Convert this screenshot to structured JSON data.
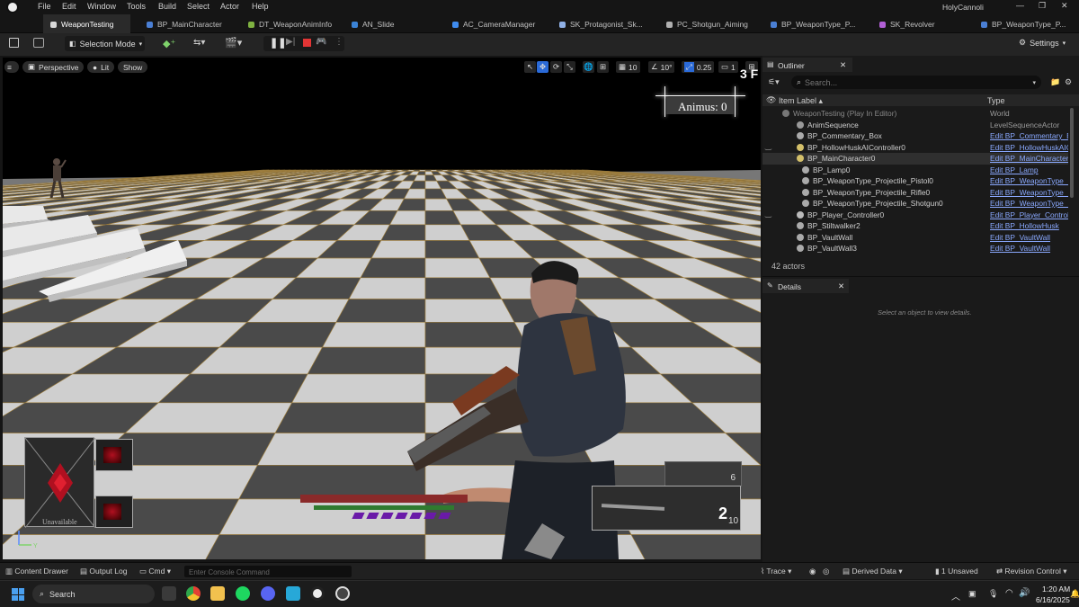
{
  "menu": [
    "File",
    "Edit",
    "Window",
    "Tools",
    "Build",
    "Select",
    "Actor",
    "Help"
  ],
  "project_name": "HolyCannoli",
  "tabs": [
    {
      "label": "WeaponTesting",
      "color": "#d8d8d8",
      "active": true
    },
    {
      "label": "BP_MainCharacter",
      "color": "#4a7fd4"
    },
    {
      "label": "DT_WeaponAnimInfo",
      "color": "#7fb241"
    },
    {
      "label": "AN_Slide",
      "color": "#3b83d6"
    },
    {
      "label": "AC_CameraManager",
      "color": "#3f8cf0"
    },
    {
      "label": "SK_Protagonist_Sk...",
      "color": "#8fb0e6"
    },
    {
      "label": "PC_Shotgun_Aiming",
      "color": "#b0b0b0"
    },
    {
      "label": "BP_WeaponType_P...",
      "color": "#4a7fd4"
    },
    {
      "label": "SK_Revolver",
      "color": "#b15fd6"
    },
    {
      "label": "BP_WeaponType_P...",
      "color": "#4a7fd4"
    }
  ],
  "toolbar": {
    "selection_mode": "Selection Mode",
    "settings": "Settings"
  },
  "viewport": {
    "perspective": "Perspective",
    "lit": "Lit",
    "show": "Show",
    "grid_snap": "10",
    "rotation_snap": "10°",
    "scale_snap": "0.25",
    "camera_speed": "1",
    "fps_fragment": "3 F",
    "animus": "Animus: 0",
    "ammo": "2",
    "ammo_reserve": "10",
    "ammo_small": "6",
    "unavailable": "Unavailable",
    "ammo_pips": 7
  },
  "outliner": {
    "title": "Outliner",
    "search_placeholder": "Search...",
    "col_label": "Item Label ▴",
    "col_type": "Type",
    "count": "42 actors",
    "rows": [
      {
        "label": "WeaponTesting (Play In Editor)",
        "type": "World",
        "indent": 0,
        "plain": true,
        "color": "#777"
      },
      {
        "label": "AnimSequence",
        "type": "LevelSequenceActor",
        "indent": 1,
        "plain": true,
        "color": "#999"
      },
      {
        "label": "BP_Commentary_Box",
        "type": "Edit BP_Commentary_Box",
        "indent": 1,
        "color": "#aaa"
      },
      {
        "label": "BP_HollowHuskAIController0",
        "type": "Edit BP_HollowHuskAICo",
        "indent": 1,
        "color": "#d4c06a"
      },
      {
        "label": "BP_MainCharacter0",
        "type": "Edit BP_MainCharacter",
        "indent": 1,
        "color": "#d4c06a",
        "sel": true
      },
      {
        "label": "BP_Lamp0",
        "type": "Edit BP_Lamp",
        "indent": 2,
        "color": "#aaa"
      },
      {
        "label": "BP_WeaponType_Projectile_Pistol0",
        "type": "Edit BP_WeaponType_Pr",
        "indent": 2,
        "color": "#aaa"
      },
      {
        "label": "BP_WeaponType_Projectile_Rifle0",
        "type": "Edit BP_WeaponType_Pr",
        "indent": 2,
        "color": "#aaa"
      },
      {
        "label": "BP_WeaponType_Projectile_Shotgun0",
        "type": "Edit BP_WeaponType_Pr",
        "indent": 2,
        "color": "#aaa"
      },
      {
        "label": "BP_Player_Controller0",
        "type": "Edit BP_Player_Controlle",
        "indent": 1,
        "color": "#bbb"
      },
      {
        "label": "BP_Stiltwalker2",
        "type": "Edit BP_HollowHusk",
        "indent": 1,
        "color": "#aaa"
      },
      {
        "label": "BP_VaultWall",
        "type": "Edit BP_VaultWall",
        "indent": 1,
        "color": "#aaa"
      },
      {
        "label": "BP_VaultWall3",
        "type": "Edit BP_VaultWall",
        "indent": 1,
        "color": "#aaa"
      }
    ]
  },
  "details": {
    "title": "Details",
    "empty": "Select an object to view details."
  },
  "statusbar": {
    "content_drawer": "Content Drawer",
    "output_log": "Output Log",
    "cmd": "Cmd",
    "console_placeholder": "Enter Console Command",
    "trace": "Trace",
    "derived_data": "Derived Data",
    "unsaved": "1 Unsaved",
    "revision_control": "Revision Control"
  },
  "taskbar": {
    "search": "Search",
    "time": "1:20 AM",
    "date": "6/16/2025"
  }
}
